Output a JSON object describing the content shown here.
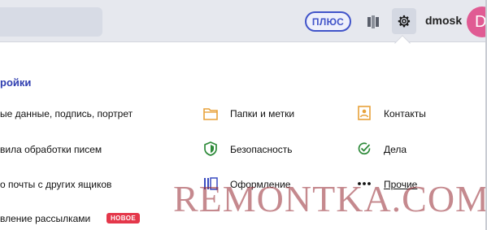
{
  "header": {
    "plus_label": "ПЛЮС",
    "username": "dmosk",
    "avatar_letter": "D"
  },
  "settings": {
    "title": "ройки",
    "items": [
      {
        "label": "ые данные, подпись, портрет"
      },
      {
        "label": "Папки и метки",
        "icon": "folder-icon"
      },
      {
        "label": "Контакты",
        "icon": "contacts-icon"
      },
      {
        "label": "вила обработки писем"
      },
      {
        "label": "Безопасность",
        "icon": "shield-icon"
      },
      {
        "label": "Дела",
        "icon": "checkmark-icon"
      },
      {
        "label": "о почты с других ящиков"
      },
      {
        "label": "Оформление",
        "icon": "appearance-icon"
      },
      {
        "label": "Прочие",
        "icon": "more-dots-icon"
      },
      {
        "label": "вление рассылками",
        "badge": "НОВОЕ"
      }
    ]
  },
  "watermark": "REMONTKA.COM",
  "colors": {
    "accent": "#4154c9",
    "title": "#2f3eb0",
    "avatar": "#e05b93",
    "icon_orange": "#e8a23a",
    "icon_green": "#2e8a3a",
    "icon_blue": "#3a4cc0",
    "badge": "#e4374a"
  }
}
